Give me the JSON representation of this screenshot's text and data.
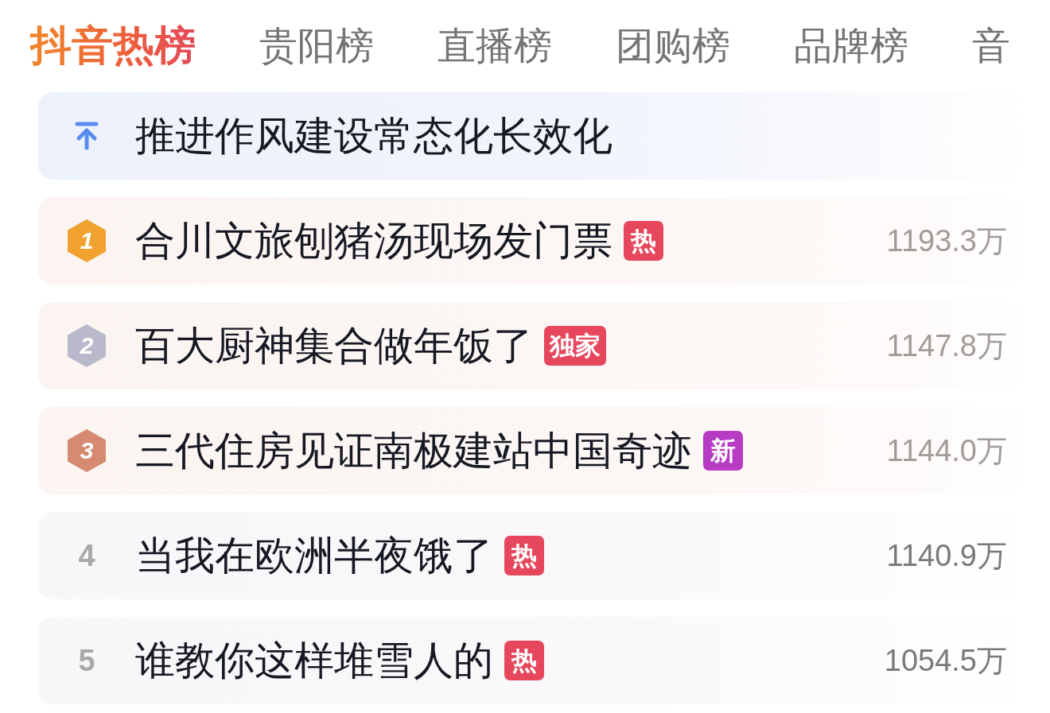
{
  "tabs": [
    {
      "label": "抖音热榜",
      "selected": true
    },
    {
      "label": "贵阳榜",
      "selected": false
    },
    {
      "label": "直播榜",
      "selected": false
    },
    {
      "label": "团购榜",
      "selected": false
    },
    {
      "label": "品牌榜",
      "selected": false
    },
    {
      "label": "音",
      "selected": false
    }
  ],
  "pinned": {
    "title": "推进作风建设常态化长效化"
  },
  "rows": [
    {
      "kind": "medal",
      "rank": "1",
      "color": "#f0a12e",
      "title": "合川文旅刨猪汤现场发门票",
      "tag": {
        "label": "热",
        "color": "#e6475c"
      },
      "heat": "1193.3万"
    },
    {
      "kind": "medal",
      "rank": "2",
      "color": "#b9b9cb",
      "title": "百大厨神集合做年饭了",
      "tag": {
        "label": "独家",
        "color": "#e6475c"
      },
      "heat": "1147.8万"
    },
    {
      "kind": "medal",
      "rank": "3",
      "color": "#d68a72",
      "title": "三代住房见证南极建站中国奇迹",
      "tag": {
        "label": "新",
        "color": "#b73cc3"
      },
      "heat": "1144.0万"
    },
    {
      "kind": "plain",
      "rank": "4",
      "title": "当我在欧洲半夜饿了",
      "tag": {
        "label": "热",
        "color": "#e6475c"
      },
      "heat": "1140.9万"
    },
    {
      "kind": "plain",
      "rank": "5",
      "title": "谁教你这样堆雪人的",
      "tag": {
        "label": "热",
        "color": "#e6475c"
      },
      "heat": "1054.5万"
    }
  ]
}
